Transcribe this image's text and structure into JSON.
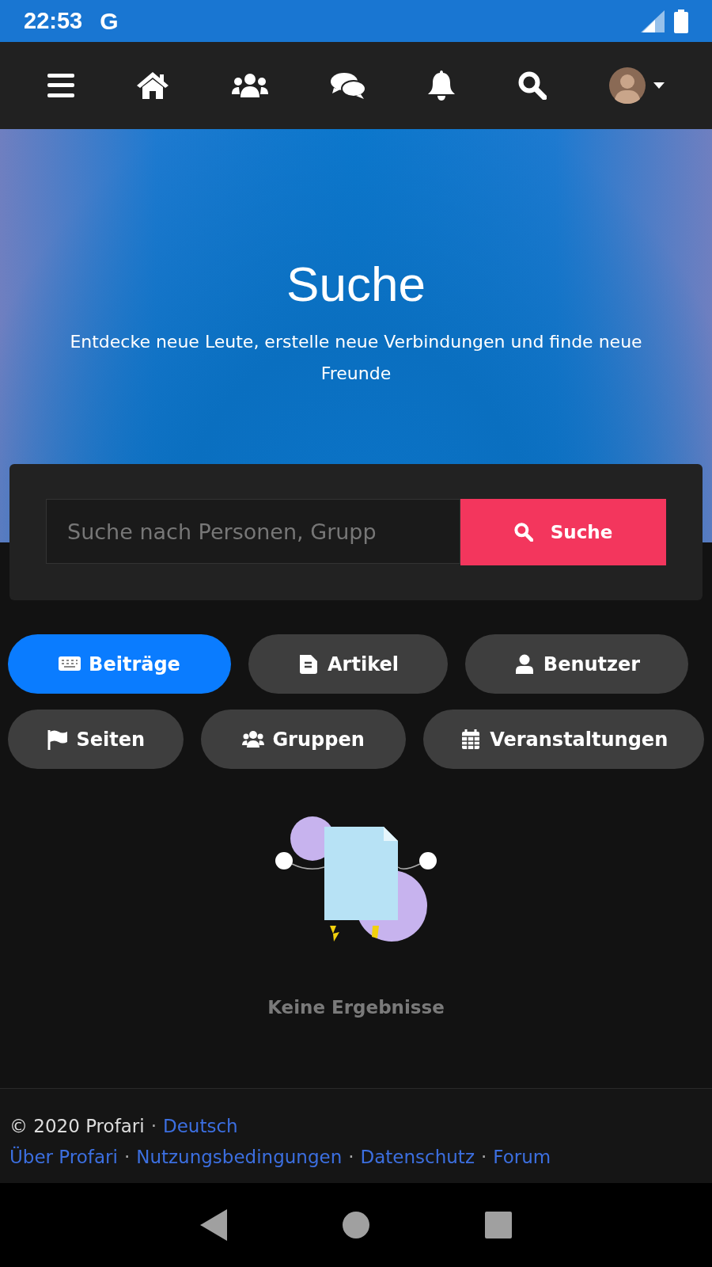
{
  "status_bar": {
    "time": "22:53",
    "app_glyph": "G"
  },
  "hero": {
    "title": "Suche",
    "subtitle": "Entdecke neue Leute, erstelle neue Verbindungen und finde neue Freunde"
  },
  "search": {
    "placeholder": "Suche nach Personen, Grupp",
    "button": "Suche"
  },
  "filters": [
    {
      "label": "Beiträge",
      "selected": true
    },
    {
      "label": "Artikel",
      "selected": false
    },
    {
      "label": "Benutzer",
      "selected": false
    },
    {
      "label": "Seiten",
      "selected": false
    },
    {
      "label": "Gruppen",
      "selected": false
    },
    {
      "label": "Veranstaltungen",
      "selected": false
    }
  ],
  "empty_state": {
    "message": "Keine Ergebnisse"
  },
  "footer": {
    "copyright": "© 2020 Profari",
    "separator": "·",
    "language": "Deutsch",
    "links": [
      "Über Profari",
      "Nutzungsbedingungen",
      "Datenschutz",
      "Forum"
    ]
  }
}
